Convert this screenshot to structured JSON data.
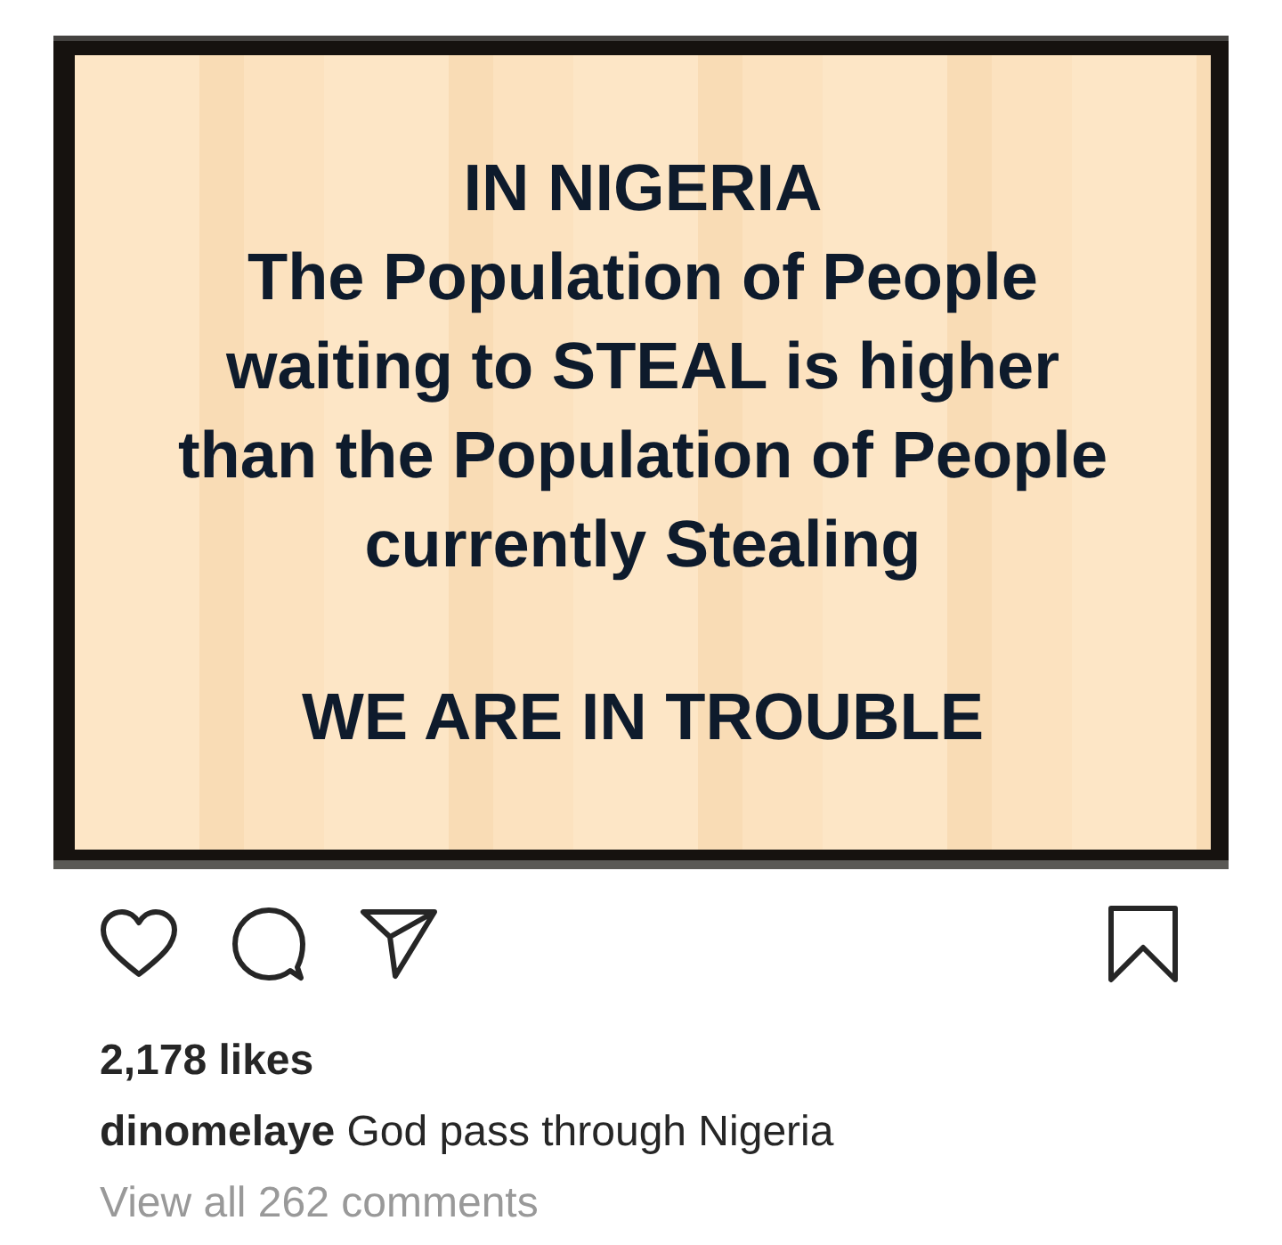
{
  "post": {
    "sign": {
      "title": "IN NIGERIA",
      "body_lines": [
        "The Population of People",
        "waiting to STEAL is higher",
        "than the Population of People",
        "currently Stealing"
      ],
      "footer": "WE ARE IN TROUBLE"
    },
    "actions": {
      "liked": false,
      "saved": false
    },
    "likes": "2,178 likes",
    "caption": {
      "username": "dinomelaye",
      "text": "God pass through Nigeria"
    },
    "comments_link": "View all 262 comments"
  }
}
